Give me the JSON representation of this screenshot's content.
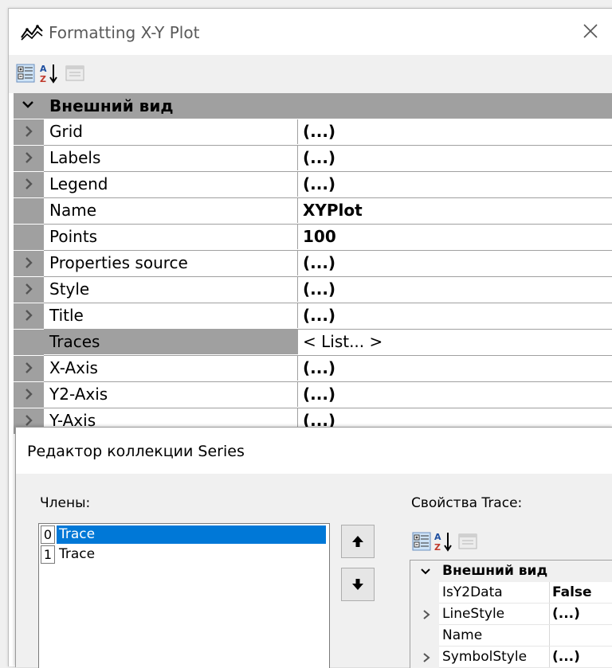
{
  "window": {
    "title": "Formatting X-Y Plot",
    "close_label": "✕"
  },
  "toolbar": {
    "categorized_icon": "categorized-icon",
    "alphabetical_icon": "alphabetical-icon",
    "property_pages_icon": "property-pages-icon"
  },
  "grid": {
    "category": "Внешний вид",
    "rows": [
      {
        "name": "Grid",
        "value": "(...)",
        "expandable": true
      },
      {
        "name": "Labels",
        "value": "(...)",
        "expandable": true
      },
      {
        "name": "Legend",
        "value": "(...)",
        "expandable": true
      },
      {
        "name": "Name",
        "value": "XYPlot",
        "expandable": false
      },
      {
        "name": "Points",
        "value": "100",
        "expandable": false
      },
      {
        "name": "Properties source",
        "value": "(...)",
        "expandable": true
      },
      {
        "name": "Style",
        "value": "(...)",
        "expandable": true
      },
      {
        "name": "Title",
        "value": "(...)",
        "expandable": true
      },
      {
        "name": "Traces",
        "value": "< List... >",
        "expandable": false,
        "selected": true
      },
      {
        "name": "X-Axis",
        "value": "(...)",
        "expandable": true
      },
      {
        "name": "Y2-Axis",
        "value": "(...)",
        "expandable": true
      },
      {
        "name": "Y-Axis",
        "value": "(...)",
        "expandable": true
      }
    ]
  },
  "dialog": {
    "title": "Редактор коллекции Series",
    "members_label": "Члены:",
    "properties_label": "Свойства Trace:",
    "members": [
      {
        "index": "0",
        "name": "Trace",
        "selected": true
      },
      {
        "index": "1",
        "name": "Trace",
        "selected": false
      }
    ],
    "move_up_icon": "arrow-up-icon",
    "move_down_icon": "arrow-down-icon",
    "mini_grid": {
      "category": "Внешний вид",
      "rows": [
        {
          "name": "IsY2Data",
          "value": "False",
          "expandable": false
        },
        {
          "name": "LineStyle",
          "value": "(...)",
          "expandable": true
        },
        {
          "name": "Name",
          "value": "",
          "expandable": false
        },
        {
          "name": "SymbolStyle",
          "value": "(...)",
          "expandable": true
        }
      ]
    }
  },
  "colors": {
    "selection": "#0078d7",
    "grid_margin": "#a0a0a0"
  }
}
